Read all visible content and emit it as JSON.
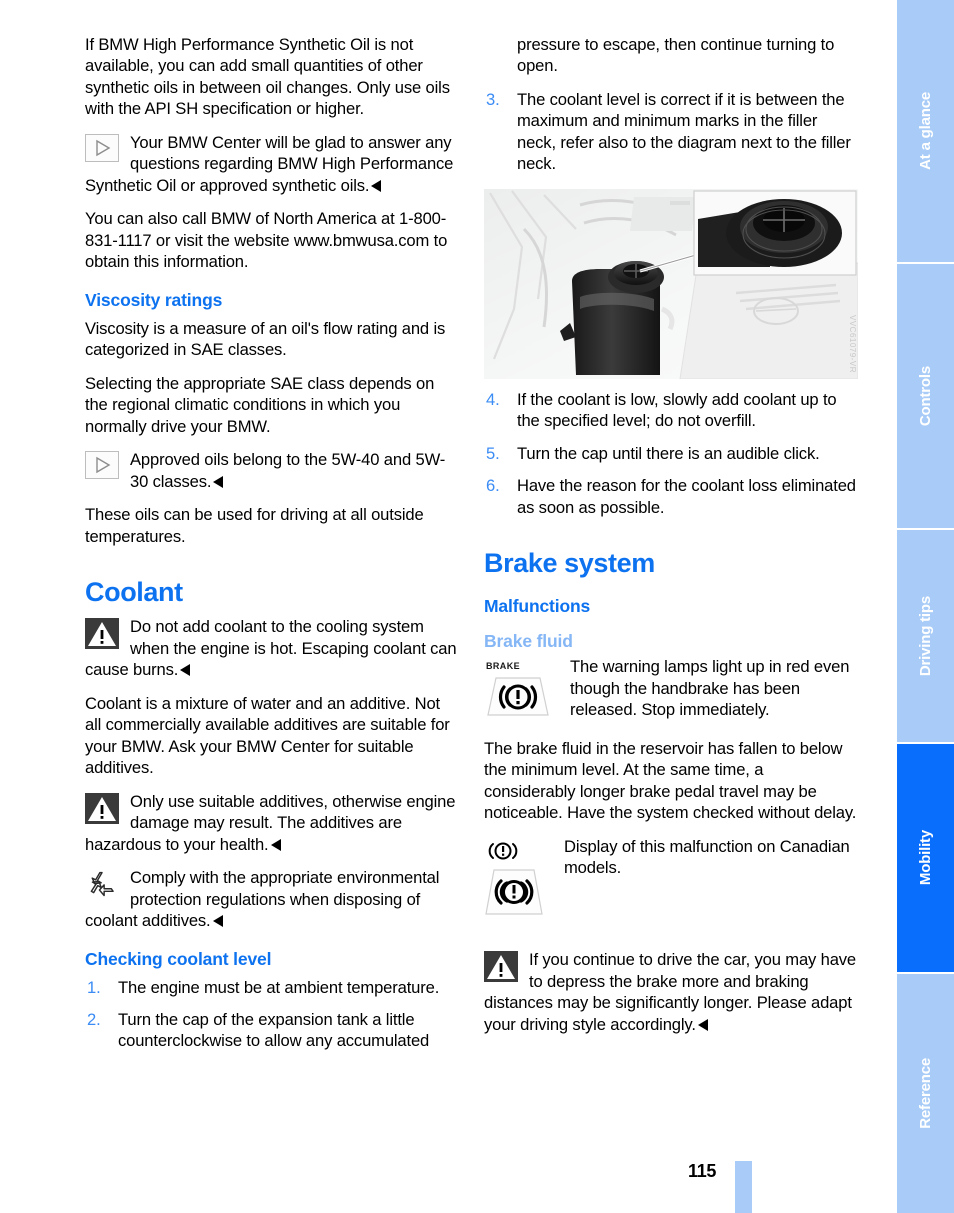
{
  "page": {
    "number": "115",
    "figure_code": "VVC61079-VR"
  },
  "left_column": {
    "intro_paragraph": "If BMW High Performance Synthetic Oil is not available, you can add small quantities of other synthetic oils in between oil changes. Only use oils with the API SH specification or higher.",
    "note_bmw_center": "Your BMW Center will be glad to answer any questions regarding BMW High Performance Synthetic Oil or approved synthetic oils.",
    "contact_paragraph": "You can also call BMW of North America at 1-800-831-1117 or visit the website www.bmwusa.com to obtain this information.",
    "viscosity_heading": "Viscosity ratings",
    "viscosity_p1": "Viscosity is a measure of an oil's flow rating and is categorized in SAE classes.",
    "viscosity_p2": "Selecting the appropriate SAE class depends on the regional climatic conditions in which you normally drive your BMW.",
    "note_approved_oils": "Approved oils belong to the 5W-40 and 5W-30 classes.",
    "viscosity_p3": "These oils can be used for driving at all outside temperatures.",
    "coolant_heading": "Coolant",
    "warn_hot_engine": "Do not add coolant to the cooling system when the engine is hot. Escaping coolant can cause burns.",
    "coolant_p1": "Coolant is a mixture of water and an additive. Not all commercially available additives are suitable for your BMW. Ask your BMW Center for suitable additives.",
    "warn_additives": "Only use suitable additives, otherwise engine damage may result. The additives are hazardous to your health.",
    "note_environment": "Comply with the appropriate environmental protection regulations when disposing of coolant additives.",
    "checking_heading": "Checking coolant level",
    "steps": [
      {
        "num": "1.",
        "text": "The engine must be at ambient temperature."
      },
      {
        "num": "2.",
        "text": "Turn the cap of the expansion tank a little counterclockwise to allow any accumulated"
      }
    ]
  },
  "right_column": {
    "continued_text": "pressure to escape, then continue turning to open.",
    "steps_top": [
      {
        "num": "3.",
        "text": "The coolant level is correct if it is between the maximum and minimum marks in the filler neck, refer also to the diagram next to the filler neck."
      }
    ],
    "steps_bottom": [
      {
        "num": "4.",
        "text": "If the coolant is low, slowly add coolant up to the specified level; do not overfill."
      },
      {
        "num": "5.",
        "text": "Turn the cap until there is an audible click."
      },
      {
        "num": "6.",
        "text": "Have the reason for the coolant loss eliminated as soon as possible."
      }
    ],
    "brake_system_heading": "Brake system",
    "malfunctions_heading": "Malfunctions",
    "brake_fluid_heading": "Brake fluid",
    "brake_lamp_note": "The warning lamps light up in red even though the handbrake has been released. Stop immediately.",
    "brake_fluid_p1": "The brake fluid in the reservoir has fallen to below the minimum level. At the same time, a considerably longer brake pedal travel may be noticeable. Have the system checked without delay.",
    "canadian_note": "Display of this malfunction on Canadian models.",
    "warn_continue_driving": "If you continue to drive the car, you may have to depress the brake more and braking distances may be significantly longer. Please adapt your driving style accordingly."
  },
  "sidenav": {
    "tabs": [
      {
        "label": "At a glance",
        "active": false
      },
      {
        "label": "Controls",
        "active": false
      },
      {
        "label": "Driving tips",
        "active": false
      },
      {
        "label": "Mobility",
        "active": true
      },
      {
        "label": "Reference",
        "active": false
      }
    ]
  },
  "icons": {
    "brake_label": "BRAKE"
  },
  "colors": {
    "heading_blue": "#0d72ef",
    "subheading_light_blue": "#85b6f5",
    "list_number_blue": "#3b8cf5",
    "nav_inactive": "#a8ccf7",
    "nav_active": "#0a6efc"
  }
}
